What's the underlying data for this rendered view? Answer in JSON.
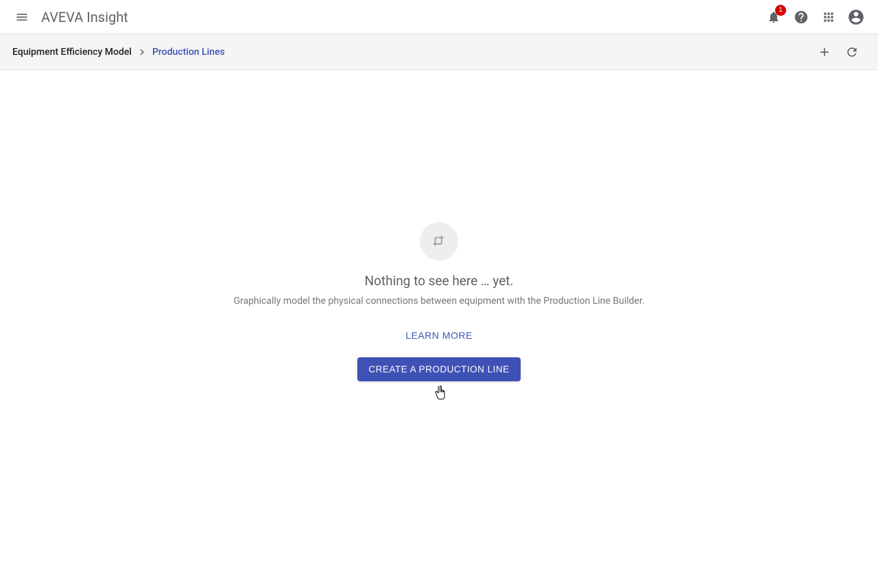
{
  "header": {
    "app_title": "AVEVA Insight",
    "notification_count": "1"
  },
  "breadcrumb": {
    "root": "Equipment Efficiency Model",
    "leaf": "Production Lines"
  },
  "empty_state": {
    "title": "Nothing to see here … yet.",
    "subtitle": "Graphically model the physical connections between equipment with the Production Line Builder.",
    "learn_more": "Learn More",
    "create_button": "Create a Production Line"
  }
}
